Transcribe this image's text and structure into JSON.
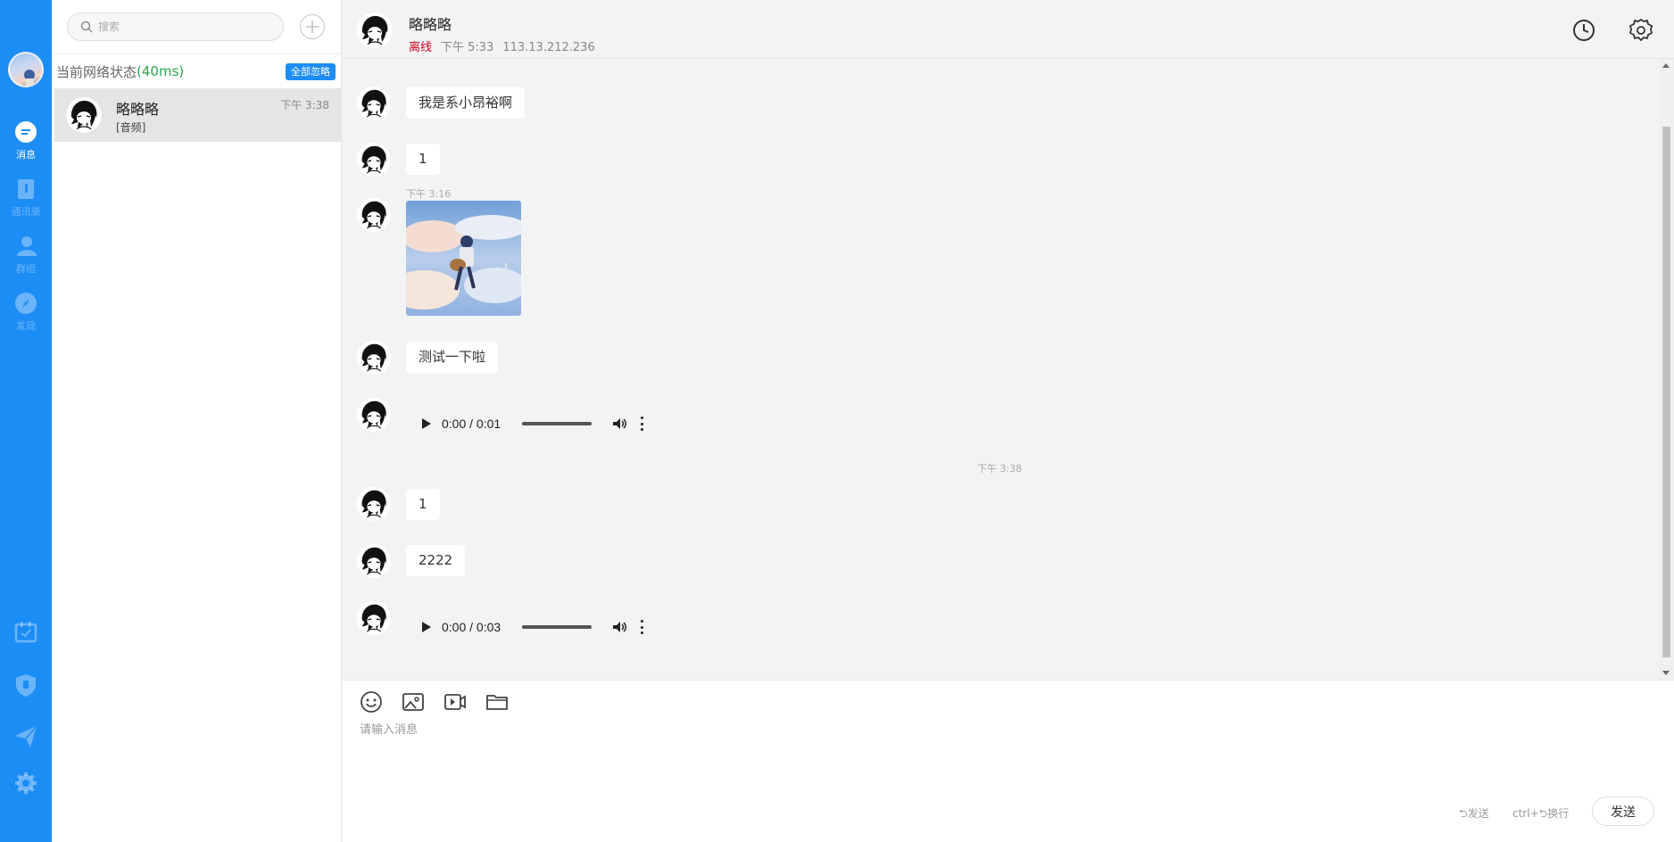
{
  "rail": {
    "items": [
      {
        "label": "消息",
        "icon": "message-icon",
        "active": true
      },
      {
        "label": "通讯录",
        "icon": "contacts-icon",
        "active": false
      },
      {
        "label": "群组",
        "icon": "group-icon",
        "active": false
      },
      {
        "label": "发现",
        "icon": "compass-icon",
        "active": false
      }
    ],
    "bottom_icons": [
      "calendar-icon",
      "shield-icon",
      "send-icon",
      "settings-icon"
    ],
    "accent_color": "#1d8df6"
  },
  "list": {
    "search_placeholder": "搜索",
    "network_label": "当前网络状态",
    "network_latency": "(40ms)",
    "ignore_all_label": "全部忽略",
    "conversations": [
      {
        "name": "略略略",
        "preview": "[音频]",
        "time": "下午 3:38"
      }
    ]
  },
  "chat": {
    "title": "略略略",
    "status": "离线",
    "last_seen": "下午 5:33",
    "ip": "113.13.212.236",
    "header_icons": [
      "history-icon",
      "settings-icon"
    ],
    "messages": [
      {
        "type": "text",
        "text": "我是系小昂裕啊"
      },
      {
        "type": "text",
        "text": "1"
      },
      {
        "type": "image",
        "time": "下午 3:16"
      },
      {
        "type": "text",
        "text": "测试一下啦"
      },
      {
        "type": "audio",
        "time": "0:00 / 0:01"
      },
      {
        "type": "divider",
        "time": "下午 3:38"
      },
      {
        "type": "text",
        "text": "1"
      },
      {
        "type": "text",
        "text": "2222"
      },
      {
        "type": "audio",
        "time": "0:00 / 0:03"
      }
    ]
  },
  "composer": {
    "tools": [
      "emoji-icon",
      "image-icon",
      "video-icon",
      "folder-icon"
    ],
    "placeholder": "请输入消息",
    "hint_send": "⮌发送",
    "hint_newline": "ctrl+⮌换行",
    "send_label": "发送"
  }
}
